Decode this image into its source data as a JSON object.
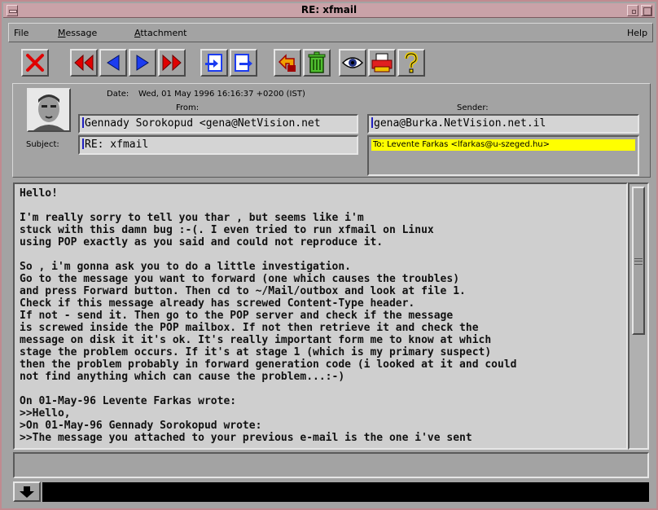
{
  "window": {
    "title": "RE: xfmail"
  },
  "menubar": {
    "file": "File",
    "message": "Message",
    "message_u": "M",
    "message_rest": "essage",
    "attachment": "Attachment",
    "attachment_u": "A",
    "attachment_rest": "ttachment",
    "help": "Help"
  },
  "toolbar": [
    {
      "name": "delete",
      "icon": "red-x-icon"
    },
    {
      "name": "first",
      "icon": "double-left-red-icon"
    },
    {
      "name": "previous",
      "icon": "left-blue-icon"
    },
    {
      "name": "next",
      "icon": "right-blue-icon"
    },
    {
      "name": "last",
      "icon": "double-right-red-icon"
    },
    {
      "name": "reply",
      "icon": "reply-icon"
    },
    {
      "name": "forward",
      "icon": "forward-icon"
    },
    {
      "name": "move",
      "icon": "move-arrow-icon"
    },
    {
      "name": "trash",
      "icon": "trash-icon"
    },
    {
      "name": "view",
      "icon": "eye-icon"
    },
    {
      "name": "print",
      "icon": "print-icon"
    },
    {
      "name": "help",
      "icon": "question-icon"
    }
  ],
  "header": {
    "date_label": "Date:",
    "date_value": "Wed, 01 May 1996 16:16:37 +0200 (IST)",
    "from_label": "From:",
    "from_value": "Gennady Sorokopud <gena@NetVision.net",
    "from_first": "G",
    "from_rest": "ennady Sorokopud <gena@NetVision.net",
    "sender_label": "Sender:",
    "sender_value": "gena@Burka.NetVision.net.il",
    "subject_label": "Subject:",
    "subject_value": "RE: xfmail",
    "subject_first": "R",
    "subject_rest": "E: xfmail",
    "to_value": "To: Levente Farkas <lfarkas@u-szeged.hu>"
  },
  "body": {
    "text": "Hello!\n\nI'm really sorry to tell you thar , but seems like i'm\nstuck with this damn bug :-(. I even tried to run xfmail on Linux\nusing POP exactly as you said and could not reproduce it.\n\nSo , i'm gonna ask you to do a little investigation.\nGo to the message you want to forward (one which causes the troubles)\nand press Forward button. Then cd to ~/Mail/outbox and look at file 1.\nCheck if this message already has screwed Content-Type header.\nIf not - send it. Then go to the POP server and check if the message\nis screwed inside the POP mailbox. If not then retrieve it and check the\nmessage on disk it it's ok. It's really important form me to know at which\nstage the problem occurs. If it's at stage 1 (which is my primary suspect)\nthen the problem probably in forward generation code (i looked at it and could\nnot find anything which can cause the problem...:-)\n\nOn 01-May-96 Levente Farkas wrote:\n>>Hello,\n>On 01-May-96 Gennady Sorokopud wrote:\n>>The message you attached to your previous e-mail is the one i've sent"
  },
  "colors": {
    "window_bg": "#a3a3a3",
    "titlebar": "#c9a2a8",
    "to_highlight": "#ffff00",
    "command_line": "#000000"
  }
}
